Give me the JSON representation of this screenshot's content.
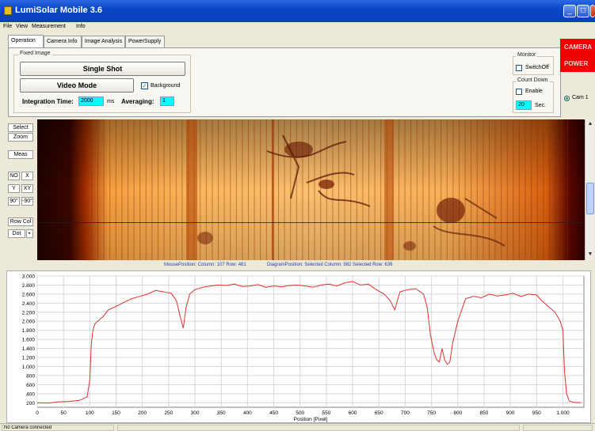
{
  "window": {
    "title": "LumiSolar Mobile 3.6"
  },
  "menu": [
    "File",
    "View",
    "Measurement",
    "Info"
  ],
  "tabs": [
    "Operation",
    "Camera Info",
    "Image Analysis",
    "PowerSupply"
  ],
  "fixed_image": {
    "group_label": "Fixed Image",
    "single_shot": "Single Shot",
    "video_mode": "Video Mode",
    "background_label": "Background",
    "background_checked": true,
    "integration_label": "Integration Time:",
    "integration_value": "2000",
    "integration_unit": "ms",
    "averaging_label": "Averaging:",
    "averaging_value": "1"
  },
  "monitor": {
    "group_label": "Monitor",
    "switch_off_label": "SwitchOff"
  },
  "countdown": {
    "group_label": "Count Down",
    "enable_label": "Enable",
    "value": "20",
    "unit": "Sec."
  },
  "right_buttons": {
    "camera": "CAMERA",
    "power": "POWER"
  },
  "cam_radio": "Cam 1",
  "sidebar": {
    "select": "Select",
    "zoom": "Zoom",
    "meas": "Meas",
    "no": "NO",
    "x": "X",
    "y": "Y",
    "xy": "XY",
    "rot_pos": "90°",
    "rot_neg": "-90°",
    "row_col": "Row Col",
    "dot": "Dot"
  },
  "status_line": {
    "mouse": "MousePosition:  Column: 107  Row: 481",
    "diagram": "DiagramPosition:  Selected Column: 982  Selected Row: 636"
  },
  "statusbar": {
    "left": "No Camera connected"
  },
  "colors": {
    "accent_red": "#f00000",
    "plot_line": "#e03030",
    "field_cyan": "#00ffff"
  },
  "chart_data": {
    "type": "line",
    "xlabel": "Position [Pixel]",
    "ylabel": "",
    "xlim": [
      0,
      1040
    ],
    "ylim": [
      100,
      3000
    ],
    "x_ticks": [
      0,
      50,
      100,
      150,
      200,
      250,
      300,
      350,
      400,
      450,
      500,
      550,
      600,
      650,
      700,
      750,
      800,
      850,
      900,
      950,
      1000
    ],
    "x_tick_labels": [
      "0",
      "50",
      "100",
      "150",
      "200",
      "250",
      "300",
      "350",
      "400",
      "450",
      "500",
      "550",
      "600",
      "650",
      "700",
      "750",
      "800",
      "850",
      "900",
      "950",
      "1.000"
    ],
    "y_ticks": [
      200,
      400,
      600,
      800,
      1000,
      1200,
      1400,
      1600,
      1800,
      2000,
      2200,
      2400,
      2600,
      2800,
      3000
    ],
    "y_tick_labels": [
      "200",
      "400",
      "600",
      "800",
      "1.000",
      "1.200",
      "1.400",
      "1.600",
      "1.800",
      "2.000",
      "2.200",
      "2.400",
      "2.600",
      "2.800",
      "3.000"
    ],
    "grid": true,
    "series": [
      {
        "x": [
          0,
          20,
          40,
          60,
          80,
          95,
          100,
          103,
          106,
          110,
          115,
          125,
          135,
          150,
          165,
          180,
          195,
          210,
          225,
          240,
          255,
          265,
          272,
          278,
          283,
          290,
          300,
          315,
          330,
          345,
          360,
          375,
          390,
          405,
          420,
          435,
          450,
          465,
          480,
          495,
          510,
          525,
          540,
          555,
          570,
          585,
          600,
          615,
          630,
          645,
          660,
          672,
          680,
          690,
          705,
          720,
          735,
          742,
          748,
          755,
          760,
          765,
          770,
          775,
          780,
          785,
          790,
          800,
          815,
          830,
          845,
          860,
          875,
          890,
          905,
          920,
          935,
          950,
          960,
          965,
          975,
          985,
          995,
          1000,
          1003,
          1007,
          1012,
          1020,
          1035
        ],
        "y": [
          200,
          190,
          220,
          230,
          250,
          330,
          700,
          1500,
          1800,
          1950,
          2000,
          2100,
          2250,
          2330,
          2420,
          2500,
          2550,
          2600,
          2680,
          2650,
          2620,
          2450,
          2100,
          1850,
          2300,
          2600,
          2700,
          2750,
          2780,
          2800,
          2790,
          2820,
          2770,
          2780,
          2810,
          2750,
          2780,
          2760,
          2790,
          2800,
          2780,
          2750,
          2800,
          2820,
          2780,
          2850,
          2880,
          2800,
          2820,
          2700,
          2600,
          2450,
          2250,
          2650,
          2700,
          2720,
          2600,
          2300,
          1700,
          1300,
          1150,
          1100,
          1400,
          1150,
          1050,
          1100,
          1500,
          2000,
          2500,
          2550,
          2520,
          2600,
          2560,
          2580,
          2620,
          2550,
          2600,
          2580,
          2450,
          2400,
          2300,
          2200,
          2000,
          1800,
          900,
          400,
          240,
          210,
          200
        ]
      }
    ]
  }
}
